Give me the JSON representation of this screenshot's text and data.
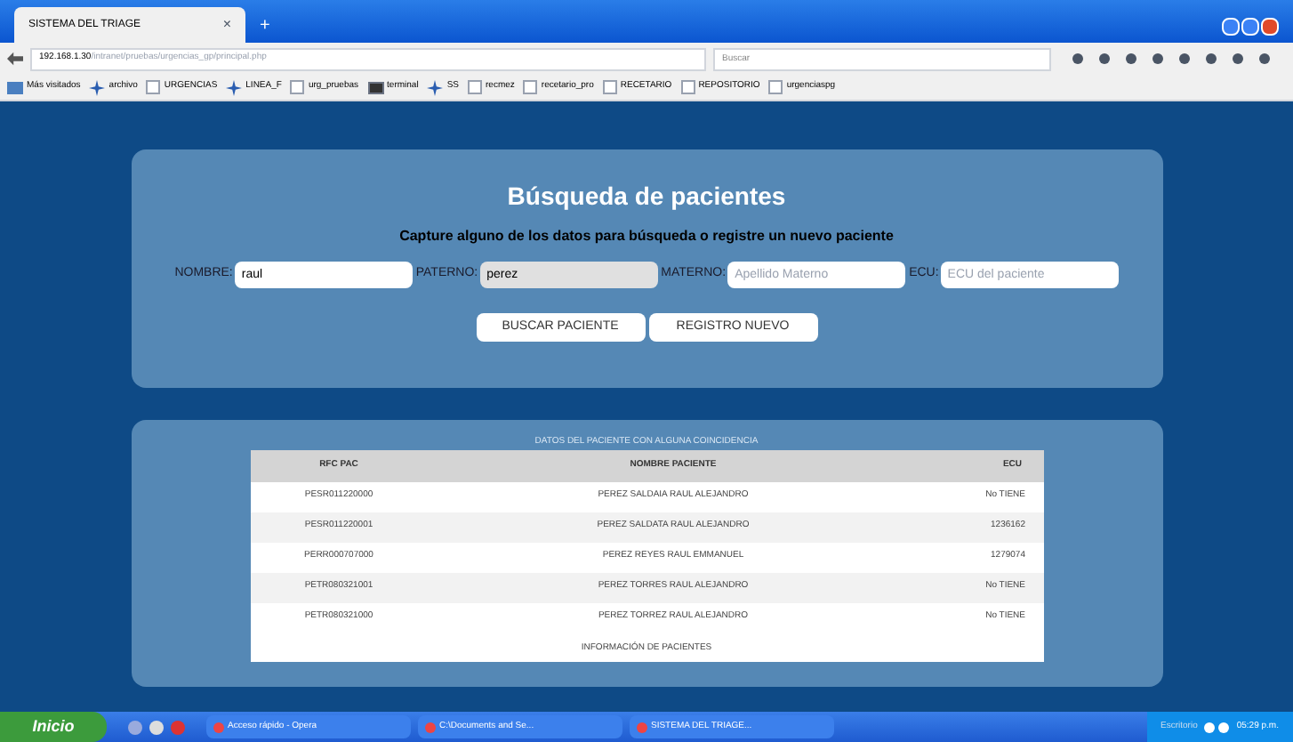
{
  "browser": {
    "tab_title": "SISTEMA DEL TRIAGE",
    "tab_close": "×",
    "new_tab": "+",
    "url_host": "192.168.1.30",
    "url_path": "/intranet/pruebas/urgencias_gp/principal.php",
    "search_placeholder": "Buscar"
  },
  "bookmarks": [
    {
      "label": "Más visitados",
      "kind": "special"
    },
    {
      "label": "archivo",
      "kind": "star"
    },
    {
      "label": "URGENCIAS",
      "kind": "page"
    },
    {
      "label": "LINEA_F",
      "kind": "star"
    },
    {
      "label": "urg_pruebas",
      "kind": "page"
    },
    {
      "label": "terminal",
      "kind": "terminal"
    },
    {
      "label": "SS",
      "kind": "star"
    },
    {
      "label": "recmez",
      "kind": "page"
    },
    {
      "label": "recetario_pro",
      "kind": "page"
    },
    {
      "label": "RECETARIO",
      "kind": "page"
    },
    {
      "label": "REPOSITORIO",
      "kind": "page"
    },
    {
      "label": "urgenciaspg",
      "kind": "page"
    }
  ],
  "search_panel": {
    "title": "Búsqueda de pacientes",
    "subtitle": "Capture alguno de los datos para búsqueda o registre un nuevo paciente",
    "fields": [
      {
        "label": "NOMBRE:",
        "value": "raul",
        "focused": false
      },
      {
        "label": "PATERNO:",
        "value": "perez",
        "focused": true
      },
      {
        "label": "MATERNO:",
        "placeholder": "Apellido Materno",
        "focused": false
      },
      {
        "label": "ECU:",
        "placeholder": "ECU del paciente",
        "focused": false
      }
    ],
    "buttons": [
      "BUSCAR PACIENTE",
      "REGISTRO NUEVO"
    ]
  },
  "results": {
    "caption": "DATOS DEL PACIENTE CON ALGUNA COINCIDENCIA",
    "columns": [
      "RFC PAC",
      "NOMBRE PACIENTE",
      "ECU"
    ],
    "rows": [
      [
        "PESR011220000",
        "PEREZ SALDAIA RAUL ALEJANDRO",
        "No TIENE"
      ],
      [
        "PESR011220001",
        "PEREZ SALDATA RAUL ALEJANDRO",
        "1236162"
      ],
      [
        "PERR000707000",
        "PEREZ REYES RAUL EMMANUEL",
        "1279074"
      ],
      [
        "PETR080321001",
        "PEREZ TORRES RAUL ALEJANDRO",
        "No TIENE"
      ],
      [
        "PETR080321000",
        "PEREZ TORREZ RAUL ALEJANDRO",
        "No TIENE"
      ]
    ],
    "footer": "INFORMACIÓN DE PACIENTES"
  },
  "taskbar": {
    "start": "Inicio",
    "items": [
      "Acceso rápido - Opera",
      "C:\\Documents and Se...",
      "SISTEMA DEL TRIAGE..."
    ],
    "tray_label": "Escritorio",
    "clock": "05:29 p.m."
  }
}
